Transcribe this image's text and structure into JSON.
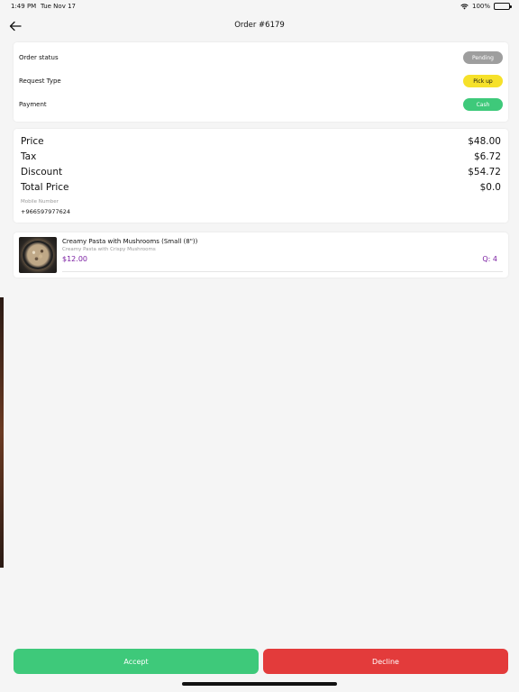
{
  "status_bar": {
    "time": "1:49 PM",
    "date": "Tue Nov 17",
    "battery": "100%"
  },
  "header": {
    "title": "Order #6179"
  },
  "order_info": [
    {
      "label": "Order status",
      "value": "Pending",
      "color": "#9e9e9e",
      "text_color": "#ffffff"
    },
    {
      "label": "Request Type",
      "value": "Pick up",
      "color": "#f6e12a",
      "text_color": "#111111"
    },
    {
      "label": "Payment",
      "value": "Cash",
      "color": "#3ec97a",
      "text_color": "#ffffff"
    }
  ],
  "pricing": [
    {
      "label": "Price",
      "value": "$48.00"
    },
    {
      "label": "Tax",
      "value": "$6.72"
    },
    {
      "label": "Discount",
      "value": "$54.72"
    },
    {
      "label": "Total Price",
      "value": "$0.0"
    }
  ],
  "mobile": {
    "label": "Mobile Number",
    "value": "+966597977624"
  },
  "item": {
    "title": "Creamy Pasta with Mushrooms (Small (8\"))",
    "description": "Creamy Pasta with Crispy Mushrooms",
    "price": "$12.00",
    "quantity": "Q: 4",
    "accent_color": "#7b1fa2"
  },
  "actions": {
    "accept_label": "Accept",
    "decline_label": "Decline",
    "accept_color": "#3ec97a",
    "decline_color": "#e33b3b"
  }
}
